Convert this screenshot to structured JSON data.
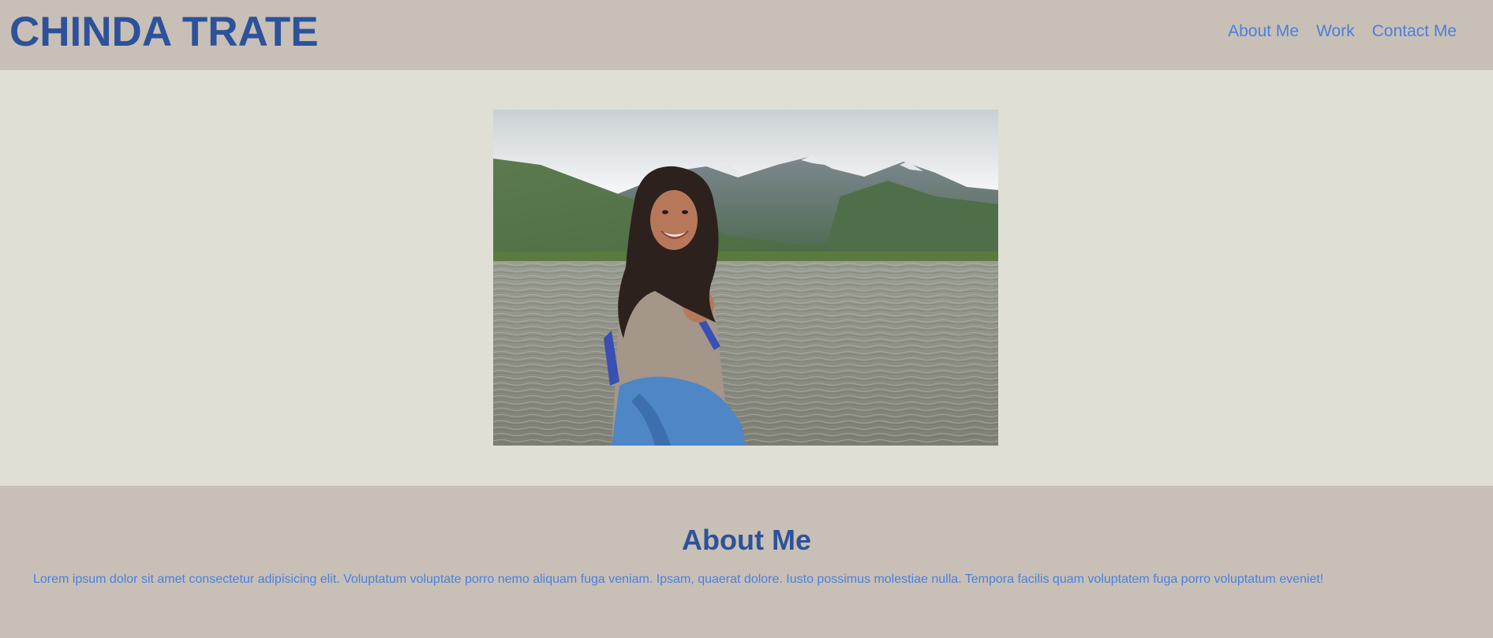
{
  "header": {
    "site_title": "CHINDA TRATE",
    "nav": [
      {
        "label": "About Me"
      },
      {
        "label": "Work"
      },
      {
        "label": "Contact Me"
      }
    ]
  },
  "hero": {
    "photo_subject": "woman-smiling-by-mountain-lake"
  },
  "about": {
    "title": "About Me",
    "body": "Lorem ipsum dolor sit amet consectetur adipisicing elit. Voluptatum voluptate porro nemo aliquam fuga veniam. Ipsam, quaerat dolore. Iusto possimus molestiae nulla. Tempora facilis quam voluptatem fuga porro voluptatum eveniet!"
  },
  "colors": {
    "header_bg": "#c8c0b6",
    "hero_bg": "#dfdfd5",
    "title_blue": "#2e529a",
    "link_blue": "#4a7fe0"
  }
}
